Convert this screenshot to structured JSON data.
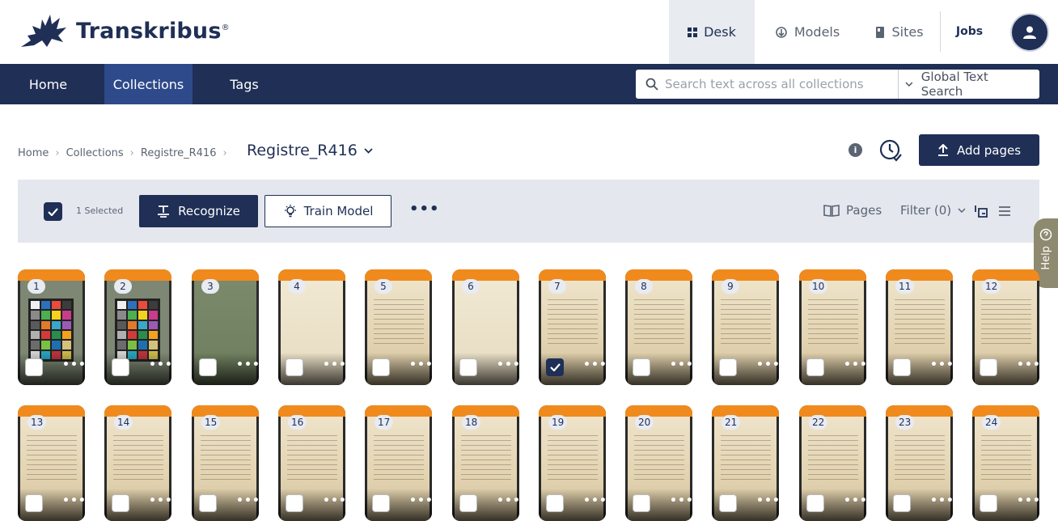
{
  "brand": {
    "name": "Transkribus",
    "mark": "®"
  },
  "topnav": {
    "items": [
      {
        "label": "Desk",
        "icon": "grid-icon",
        "active": true
      },
      {
        "label": "Models",
        "icon": "models-icon",
        "active": false
      },
      {
        "label": "Sites",
        "icon": "sites-icon",
        "active": false
      }
    ],
    "jobs_label": "Jobs"
  },
  "mainnav": {
    "items": [
      {
        "label": "Home",
        "active": false
      },
      {
        "label": "Collections",
        "active": true
      },
      {
        "label": "Tags",
        "active": false
      }
    ]
  },
  "search": {
    "placeholder": "Search text across all collections",
    "scope_label": "Global Text Search"
  },
  "breadcrumb": {
    "items": [
      "Home",
      "Collections",
      "Registre_R416"
    ],
    "current": "Registre_R416"
  },
  "header": {
    "add_pages_label": "Add pages"
  },
  "toolbar": {
    "selected_count_label": "1 Selected",
    "recognize_label": "Recognize",
    "train_label": "Train Model",
    "more_label": "•••",
    "pages_label": "Pages",
    "filter_label": "Filter (0)"
  },
  "help_label": "Help",
  "colors": {
    "primary": "#1f2f55",
    "accent": "#f08a1c",
    "toolbar_bg": "#e4e7ee"
  },
  "pages": [
    {
      "num": "1",
      "kind": "colorchart",
      "checked": false
    },
    {
      "num": "2",
      "kind": "colorchart",
      "checked": false
    },
    {
      "num": "3",
      "kind": "green",
      "checked": false
    },
    {
      "num": "4",
      "kind": "pale",
      "checked": false
    },
    {
      "num": "5",
      "kind": "text",
      "checked": false
    },
    {
      "num": "6",
      "kind": "pale",
      "checked": false
    },
    {
      "num": "7",
      "kind": "text",
      "checked": true
    },
    {
      "num": "8",
      "kind": "text",
      "checked": false
    },
    {
      "num": "9",
      "kind": "text",
      "checked": false
    },
    {
      "num": "10",
      "kind": "text",
      "checked": false
    },
    {
      "num": "11",
      "kind": "text",
      "checked": false
    },
    {
      "num": "12",
      "kind": "text",
      "checked": false
    },
    {
      "num": "13",
      "kind": "text",
      "checked": false
    },
    {
      "num": "14",
      "kind": "text",
      "checked": false
    },
    {
      "num": "15",
      "kind": "text",
      "checked": false
    },
    {
      "num": "16",
      "kind": "text",
      "checked": false
    },
    {
      "num": "17",
      "kind": "text",
      "checked": false
    },
    {
      "num": "18",
      "kind": "text",
      "checked": false
    },
    {
      "num": "19",
      "kind": "text",
      "checked": false
    },
    {
      "num": "20",
      "kind": "text",
      "checked": false
    },
    {
      "num": "21",
      "kind": "text",
      "checked": false
    },
    {
      "num": "22",
      "kind": "text",
      "checked": false
    },
    {
      "num": "23",
      "kind": "text",
      "checked": false
    },
    {
      "num": "24",
      "kind": "text",
      "checked": false
    }
  ]
}
